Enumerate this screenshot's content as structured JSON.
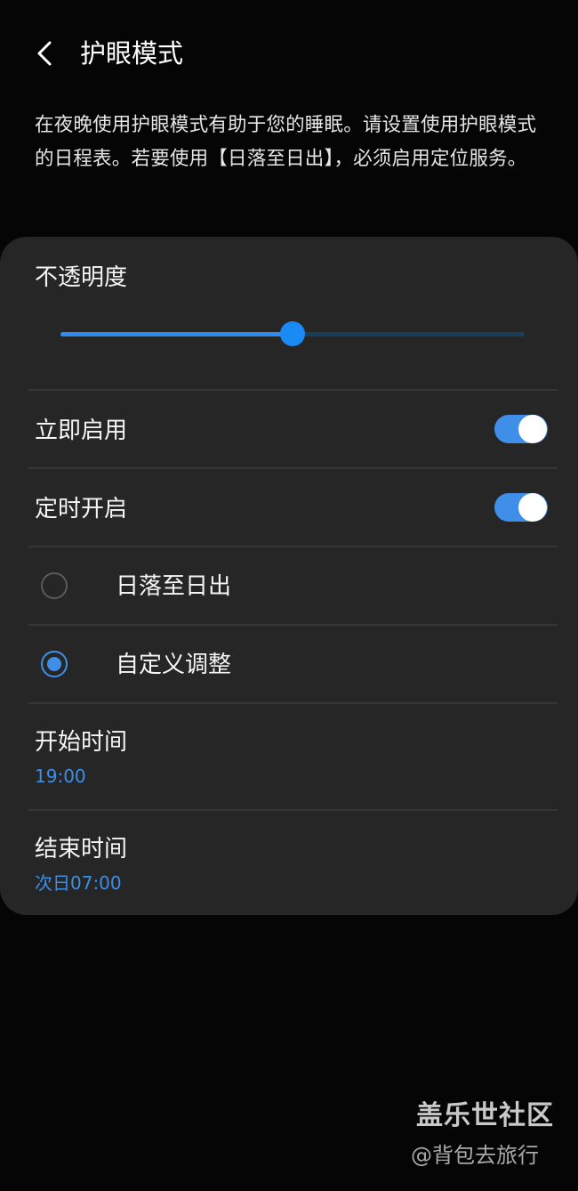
{
  "header": {
    "title": "护眼模式",
    "back_icon": "chevron-left-icon"
  },
  "description": "在夜晚使用护眼模式有助于您的睡眠。请设置使用护眼模式的日程表。若要使用【日落至日出】，必须启用定位服务。",
  "settings": {
    "opacity": {
      "label": "不透明度",
      "value_fraction": 0.5
    },
    "turn_on_now": {
      "label": "立即启用",
      "enabled": true
    },
    "scheduled": {
      "label": "定时开启",
      "enabled": true
    },
    "schedule_options": [
      {
        "label": "日落至日出",
        "selected": false
      },
      {
        "label": "自定义调整",
        "selected": true
      }
    ],
    "start_time": {
      "label": "开始时间",
      "value": "19:00"
    },
    "end_time": {
      "label": "结束时间",
      "value": "次日07:00"
    }
  },
  "watermark": {
    "brand": "盖乐世社区",
    "author": "@背包去旅行"
  },
  "colors": {
    "background": "#050505",
    "card": "#262626",
    "accent": "#3f8fe8"
  }
}
